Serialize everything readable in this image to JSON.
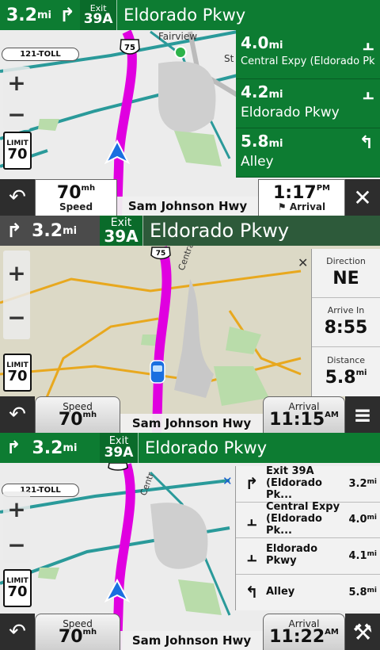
{
  "screen1": {
    "topbar": {
      "distance": "3.2",
      "unit": "mi",
      "turn_icon": "turn-right-icon",
      "exit_label": "Exit",
      "exit_number": "39A",
      "street": "Eldorado Pkwy"
    },
    "map": {
      "place": "Fairview",
      "route_shield": "75",
      "toll_label": "121-TOLL"
    },
    "speed_limit": {
      "label": "LIMIT",
      "value": "70"
    },
    "turns": [
      {
        "distance": "4.0",
        "unit": "mi",
        "name": "Central Expy (Eldorado Pk...",
        "icon": "keep-right-icon"
      },
      {
        "distance": "4.2",
        "unit": "mi",
        "name": "Eldorado Pkwy",
        "icon": "keep-right-icon"
      },
      {
        "distance": "5.8",
        "unit": "mi",
        "name": "Alley",
        "icon": "turn-left-icon"
      }
    ],
    "bottombar": {
      "speed_value": "70",
      "speed_unit": "mh",
      "speed_caption": "Speed",
      "street": "Sam Johnson Hwy",
      "arrival_value": "1:17",
      "arrival_unit": "PM",
      "arrival_caption": "Arrival",
      "close_icon": "close-icon"
    }
  },
  "screen2": {
    "topbar": {
      "distance": "3.2",
      "unit": "mi",
      "exit_label": "Exit",
      "exit_number": "39A",
      "street": "Eldorado Pkwy"
    },
    "map": {
      "route_shield": "75",
      "road_label": "Central"
    },
    "speed_limit": {
      "label": "LIMIT",
      "value": "70"
    },
    "info": [
      {
        "caption": "Direction",
        "value": "NE",
        "unit": ""
      },
      {
        "caption": "Arrive In",
        "value": "8:55",
        "unit": ""
      },
      {
        "caption": "Distance",
        "value": "5.8",
        "unit": "mi"
      }
    ],
    "bottombar": {
      "speed_caption": "Speed",
      "speed_value": "70",
      "speed_unit": "mh",
      "street": "Sam Johnson Hwy",
      "arrival_caption": "Arrival",
      "arrival_value": "11:15",
      "arrival_unit": "AM"
    }
  },
  "screen3": {
    "topbar": {
      "distance": "3.2",
      "unit": "mi",
      "exit_label": "Exit",
      "exit_number": "39A",
      "street": "Eldorado Pkwy"
    },
    "map": {
      "toll_label": "121-TOLL",
      "road_label": "Centr",
      "route_shield": "75"
    },
    "speed_limit": {
      "label": "LIMIT",
      "value": "70"
    },
    "turns": [
      {
        "name": "Exit 39A (Eldorado Pk...",
        "distance": "3.2",
        "unit": "mi",
        "icon": "exit-right-icon"
      },
      {
        "name": "Central Expy (Eldorado Pk...",
        "distance": "4.0",
        "unit": "mi",
        "icon": "keep-right-icon"
      },
      {
        "name": "Eldorado Pkwy",
        "distance": "4.1",
        "unit": "mi",
        "icon": "keep-right-icon"
      },
      {
        "name": "Alley",
        "distance": "5.8",
        "unit": "mi",
        "icon": "turn-left-icon"
      }
    ],
    "bottombar": {
      "speed_caption": "Speed",
      "speed_value": "70",
      "speed_unit": "mh",
      "street": "Sam Johnson Hwy",
      "arrival_caption": "Arrival",
      "arrival_value": "11:22",
      "arrival_unit": "AM"
    }
  },
  "colors": {
    "nav_green": "#0d7c32",
    "route_magenta": "#e000e0",
    "topbar_dark": "#2d5a3a"
  }
}
